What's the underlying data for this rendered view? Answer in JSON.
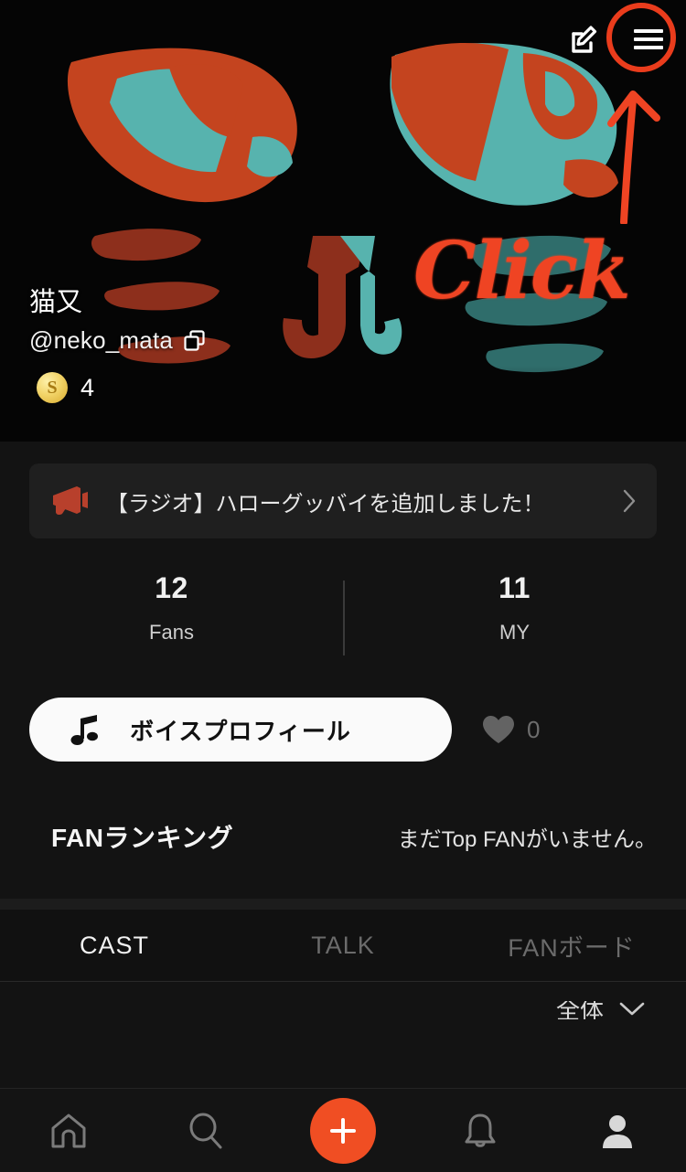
{
  "meta": {
    "accent_orange": "#f04e23",
    "annotation_red": "#ef4423",
    "art_teal": "#4fb3ae",
    "art_orange": "#c4441f",
    "page_bg": "#131313"
  },
  "hero": {
    "edit_icon": "edit-pencil-icon",
    "menu_icon": "hamburger-menu-icon",
    "annotation": {
      "text": "Click",
      "arrow_icon": "up-arrow-annotation",
      "ring_icon": "circle-highlight-annotation"
    },
    "profile": {
      "name": "猫又",
      "handle": "@neko_mata",
      "copy_icon": "copy-icon",
      "coin_symbol": "S",
      "coin_count": "4"
    }
  },
  "notice": {
    "icon": "megaphone-icon",
    "text": "【ラジオ】ハローグッバイを追加しました！",
    "chevron_icon": "chevron-right-icon"
  },
  "stats": [
    {
      "value": "12",
      "label": "Fans"
    },
    {
      "value": "11",
      "label": "MY"
    }
  ],
  "voice": {
    "icon": "music-note-icon",
    "label": "ボイスプロフィール",
    "like_icon": "heart-icon",
    "like_count": "0"
  },
  "fan_ranking": {
    "title": "FANランキング",
    "empty_text": "まだTop FANがいません。"
  },
  "tabs": [
    {
      "label": "CAST",
      "active": true
    },
    {
      "label": "TALK",
      "active": false
    },
    {
      "label": "FANボード",
      "active": false
    }
  ],
  "filter": {
    "label": "全体",
    "chevron_icon": "chevron-down-icon"
  },
  "bottom_nav": [
    {
      "icon": "home-icon",
      "active": false
    },
    {
      "icon": "search-icon",
      "active": false
    },
    {
      "icon": "plus-icon",
      "active": false
    },
    {
      "icon": "bell-icon",
      "active": false
    },
    {
      "icon": "person-icon",
      "active": true
    }
  ]
}
